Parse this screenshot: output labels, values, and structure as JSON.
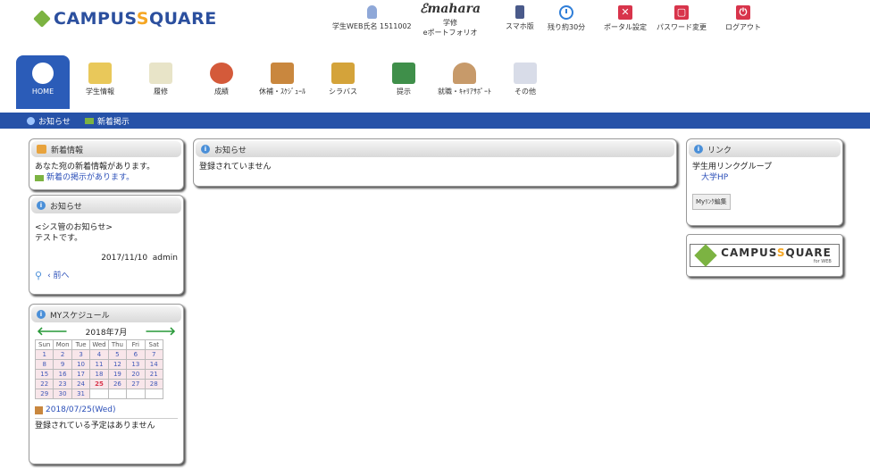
{
  "logo": {
    "part1": "CAMPUS",
    "part2": "S",
    "part3": "QUARE"
  },
  "toplinks": [
    {
      "name": "student-info",
      "label": "学生WEB氏名 1511002",
      "sub": ""
    },
    {
      "name": "mahara",
      "label": "学修",
      "sub": "eポートフォリオ",
      "brand": "mahara"
    },
    {
      "name": "smartphone",
      "label": "スマホ版",
      "sub": ""
    },
    {
      "name": "remaining-time",
      "label": "残り約30分",
      "sub": ""
    },
    {
      "name": "portal-settings",
      "label": "ポータル設定",
      "sub": ""
    },
    {
      "name": "password-change",
      "label": "パスワード変更",
      "sub": ""
    },
    {
      "name": "logout",
      "label": "ログアウト",
      "sub": ""
    }
  ],
  "menu": [
    {
      "name": "home",
      "label": "HOME",
      "active": true
    },
    {
      "name": "student-info",
      "label": "学生情報"
    },
    {
      "name": "registration",
      "label": "履修"
    },
    {
      "name": "grades",
      "label": "成績"
    },
    {
      "name": "cancellation",
      "label": "休補・ｽｹｼﾞｭｰﾙ"
    },
    {
      "name": "syllabus",
      "label": "シラバス"
    },
    {
      "name": "submission",
      "label": "提示"
    },
    {
      "name": "career",
      "label": "就職・ｷｬﾘｱｻﾎﾟｰﾄ"
    },
    {
      "name": "other",
      "label": "その他"
    }
  ],
  "subnav": {
    "notices": "お知らせ",
    "new_board": "新着掲示"
  },
  "new_info": {
    "title": "新着情報",
    "line1": "あなた宛の新着情報があります。",
    "line2": "新着の掲示があります。"
  },
  "notice_small": {
    "title": "お知らせ",
    "heading": "<シス管のお知らせ>",
    "body": "テストです。",
    "date": "2017/11/10",
    "author": "admin",
    "prev": "前へ"
  },
  "schedule": {
    "title": "MYスケジュール",
    "month": "2018年7月",
    "weekdays": [
      "Sun",
      "Mon",
      "Tue",
      "Wed",
      "Thu",
      "Fri",
      "Sat"
    ],
    "weeks": [
      [
        "1",
        "2",
        "3",
        "4",
        "5",
        "6",
        "7"
      ],
      [
        "8",
        "9",
        "10",
        "11",
        "12",
        "13",
        "14"
      ],
      [
        "15",
        "16",
        "17",
        "18",
        "19",
        "20",
        "21"
      ],
      [
        "22",
        "23",
        "24",
        "25",
        "26",
        "27",
        "28"
      ],
      [
        "29",
        "30",
        "31",
        "",
        "",
        "",
        ""
      ]
    ],
    "today": "25",
    "selected_date": "2018/07/25(Wed)",
    "empty_message": "登録されている予定はありません"
  },
  "notice_main": {
    "title": "お知らせ",
    "body": "登録されていません"
  },
  "links": {
    "title": "リンク",
    "group": "学生用リンクグループ",
    "item": "大学HP",
    "edit": "Myﾘﾝｸ編集"
  },
  "banner": {
    "part1": "CAMPUS",
    "part2": "S",
    "part3": "QUARE",
    "sub": "for WEB"
  }
}
